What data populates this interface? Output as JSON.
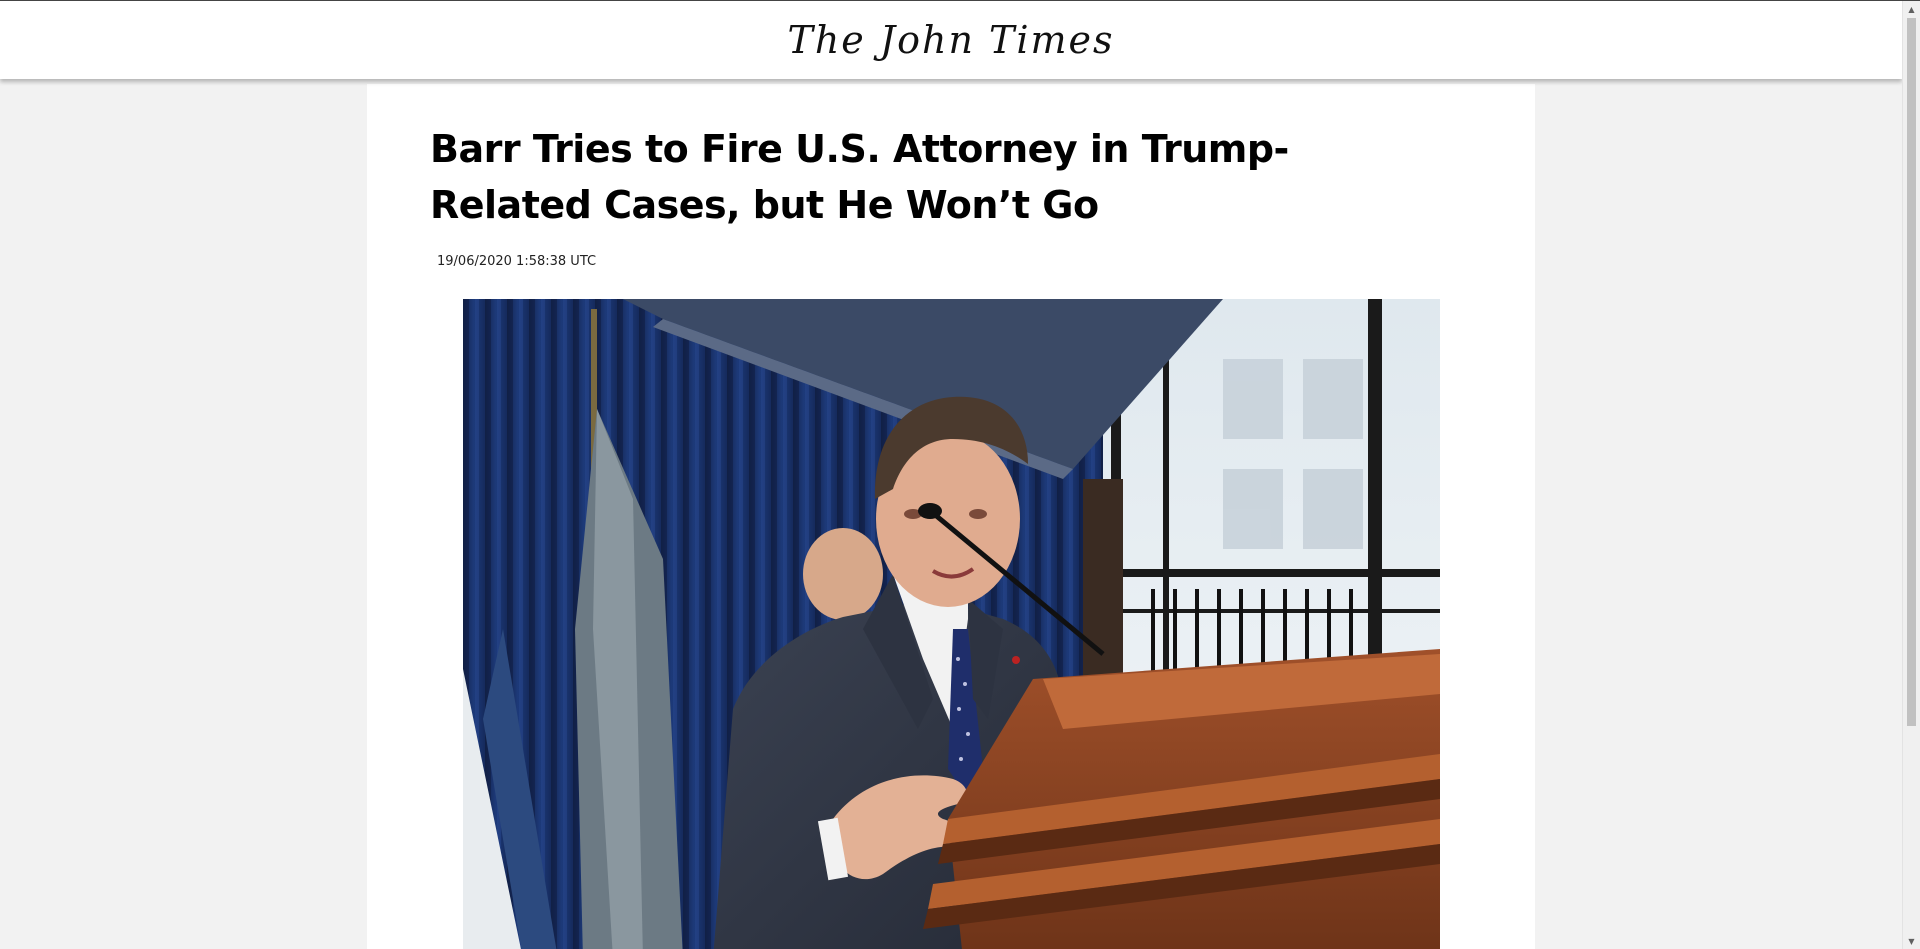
{
  "site": {
    "name": "The John Times"
  },
  "article": {
    "headline": "Barr Tries to Fire U.S. Attorney in Trump-Related Cases, but He Won’t Go",
    "timestamp": "19/06/2020 1:58:38 UTC",
    "image_alt": "A man in a dark suit speaking at a wooden podium in front of blue curtains and flags"
  },
  "colors": {
    "page_background": "#f2f2f2",
    "card_background": "#ffffff",
    "header_background": "#ffffff",
    "text": "#000000"
  },
  "icons": {
    "scroll_up": "scroll-up-arrow-icon",
    "scroll_down": "scroll-down-arrow-icon"
  }
}
